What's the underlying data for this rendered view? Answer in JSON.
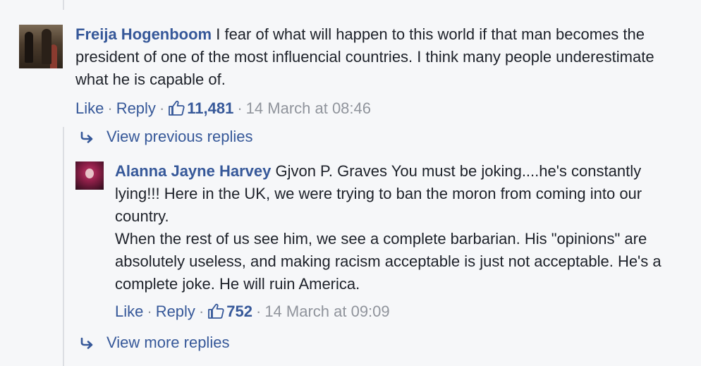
{
  "comment": {
    "author": "Freija Hogenboom",
    "text": " I fear of what will happen to this world if that man becomes the president of one of the most influencial countries. I think many people underestimate what he is capable of.",
    "like_label": "Like",
    "reply_label": "Reply",
    "like_count": "11,481",
    "timestamp": "14 March at 08:46"
  },
  "view_previous_replies": "View previous replies",
  "reply": {
    "author": "Alanna Jayne Harvey",
    "text_line1": " Gjvon P. Graves You must be joking....he's constantly lying!!! Here in the UK, we were trying to ban the moron from coming into our country.",
    "text_line2": "When the rest of us see him, we see a complete barbarian. His \"opinions\" are absolutely useless, and making racism acceptable is just not acceptable. He's a complete joke. He will ruin America.",
    "like_label": "Like",
    "reply_label": "Reply",
    "like_count": "752",
    "timestamp": "14 March at 09:09"
  },
  "view_more_replies": "View more replies",
  "separator": "·",
  "colors": {
    "link": "#365899",
    "meta": "#90949c",
    "text": "#1d2129",
    "background": "#f6f7f9",
    "thread_line": "#dcdee3"
  },
  "icons": {
    "like": "thumbs-up-icon",
    "reply_arrow": "reply-arrow-icon"
  }
}
